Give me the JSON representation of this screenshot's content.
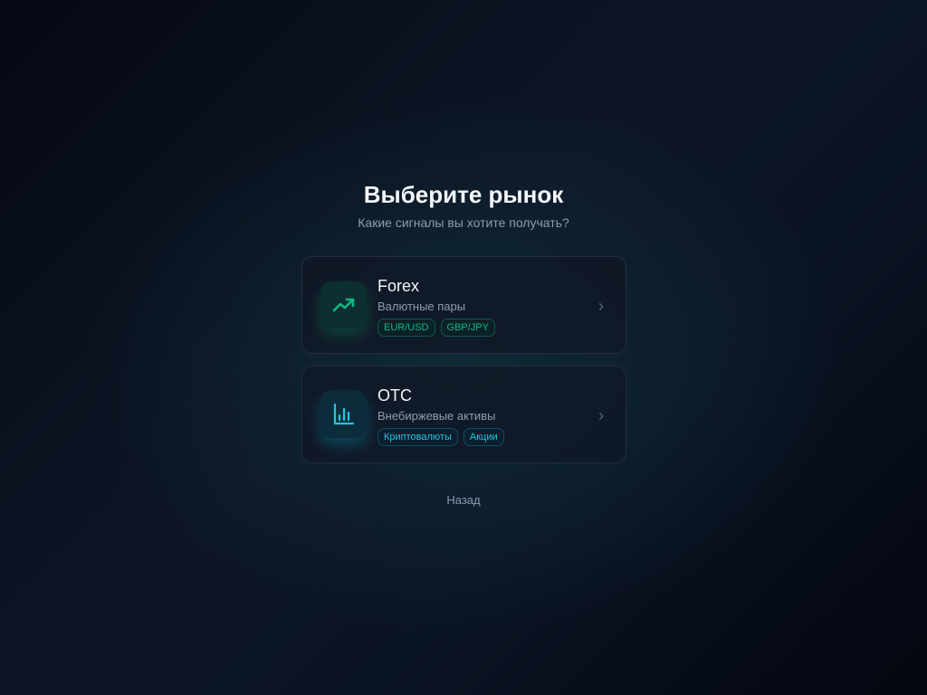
{
  "title": "Выберите рынок",
  "subtitle": "Какие сигналы вы хотите получать?",
  "markets": [
    {
      "name": "Forex",
      "description": "Валютные пары",
      "tags": [
        "EUR/USD",
        "GBP/JPY"
      ],
      "icon": "trending-up-icon",
      "color": "#10b981"
    },
    {
      "name": "OTC",
      "description": "Внебиржевые активы",
      "tags": [
        "Криптовалюты",
        "Акции"
      ],
      "icon": "bar-chart-icon",
      "color": "#22c5e0"
    }
  ],
  "back_label": "Назад"
}
